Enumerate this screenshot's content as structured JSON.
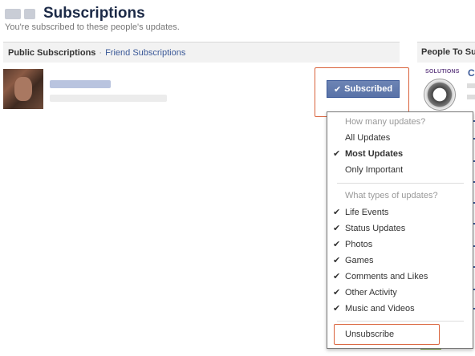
{
  "header": {
    "title": "Subscriptions",
    "subtitle": "You're subscribed to these people's updates."
  },
  "tabs": {
    "public": "Public Subscriptions",
    "separator": "·",
    "friend": "Friend Subscriptions"
  },
  "sidebar": {
    "title": "People To Su",
    "solutions": "SOLUTIONS",
    "name": "Ci"
  },
  "subscription": {
    "button_label": "Subscribed",
    "button_icon": "check-icon"
  },
  "dropdown": {
    "header_how_many": "How many updates?",
    "updates": [
      {
        "label": "All Updates",
        "checked": false,
        "bold": false
      },
      {
        "label": "Most Updates",
        "checked": true,
        "bold": true
      },
      {
        "label": "Only Important",
        "checked": false,
        "bold": false
      }
    ],
    "header_types": "What types of updates?",
    "types": [
      {
        "label": "Life Events",
        "checked": true
      },
      {
        "label": "Status Updates",
        "checked": true
      },
      {
        "label": "Photos",
        "checked": true
      },
      {
        "label": "Games",
        "checked": true
      },
      {
        "label": "Comments and Likes",
        "checked": true
      },
      {
        "label": "Other Activity",
        "checked": true
      },
      {
        "label": "Music and Videos",
        "checked": true
      }
    ],
    "unsubscribe": "Unsubscribe"
  },
  "colors": {
    "brand": "#3b5998",
    "highlight": "#d9623b"
  }
}
